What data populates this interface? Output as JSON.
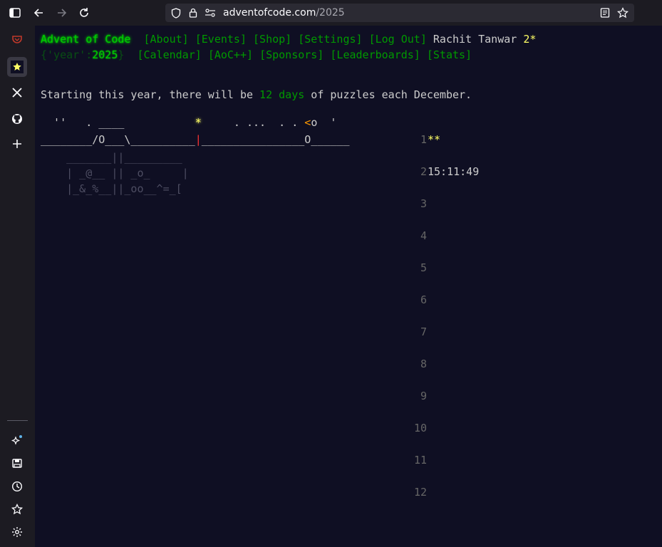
{
  "browser": {
    "url_domain": "adventofcode.com",
    "url_path": "/2025"
  },
  "site": {
    "title": "Advent of Code",
    "nav_row1": [
      "[About]",
      "[Events]",
      "[Shop]",
      "[Settings]",
      "[Log Out]"
    ],
    "user_name": "Rachit Tanwar",
    "user_stars": "2*",
    "year_prefix": "{'year':",
    "year_value": "2025",
    "year_suffix": "}",
    "nav_row2": [
      "[Calendar]",
      "[AoC++]",
      "[Sponsors]",
      "[Leaderboards]",
      "[Stats]"
    ]
  },
  "intro": {
    "pre": "Starting this year, there will be ",
    "days": "12 days",
    "post": " of puzzles each December."
  },
  "art": {
    "row1": {
      "a": "  ''   . ____",
      "b": "*",
      "c": "     . ...  . . ",
      "d": "<",
      "e": "o  '"
    },
    "row2": {
      "a": "________/O___\\__________",
      "b": "|",
      "c": "________________O______"
    },
    "row3": "    _______||_________",
    "row4": "    | _@__ || _o_     |",
    "row5": "    |_&_%__||_oo__^=_["
  },
  "calendar": [
    {
      "day": "1",
      "status": "**"
    },
    {
      "day": "2",
      "status": "15:11:49"
    },
    {
      "day": "3",
      "status": ""
    },
    {
      "day": "4",
      "status": ""
    },
    {
      "day": "5",
      "status": ""
    },
    {
      "day": "6",
      "status": ""
    },
    {
      "day": "7",
      "status": ""
    },
    {
      "day": "8",
      "status": ""
    },
    {
      "day": "9",
      "status": ""
    },
    {
      "day": "10",
      "status": ""
    },
    {
      "day": "11",
      "status": ""
    },
    {
      "day": "12",
      "status": ""
    }
  ]
}
